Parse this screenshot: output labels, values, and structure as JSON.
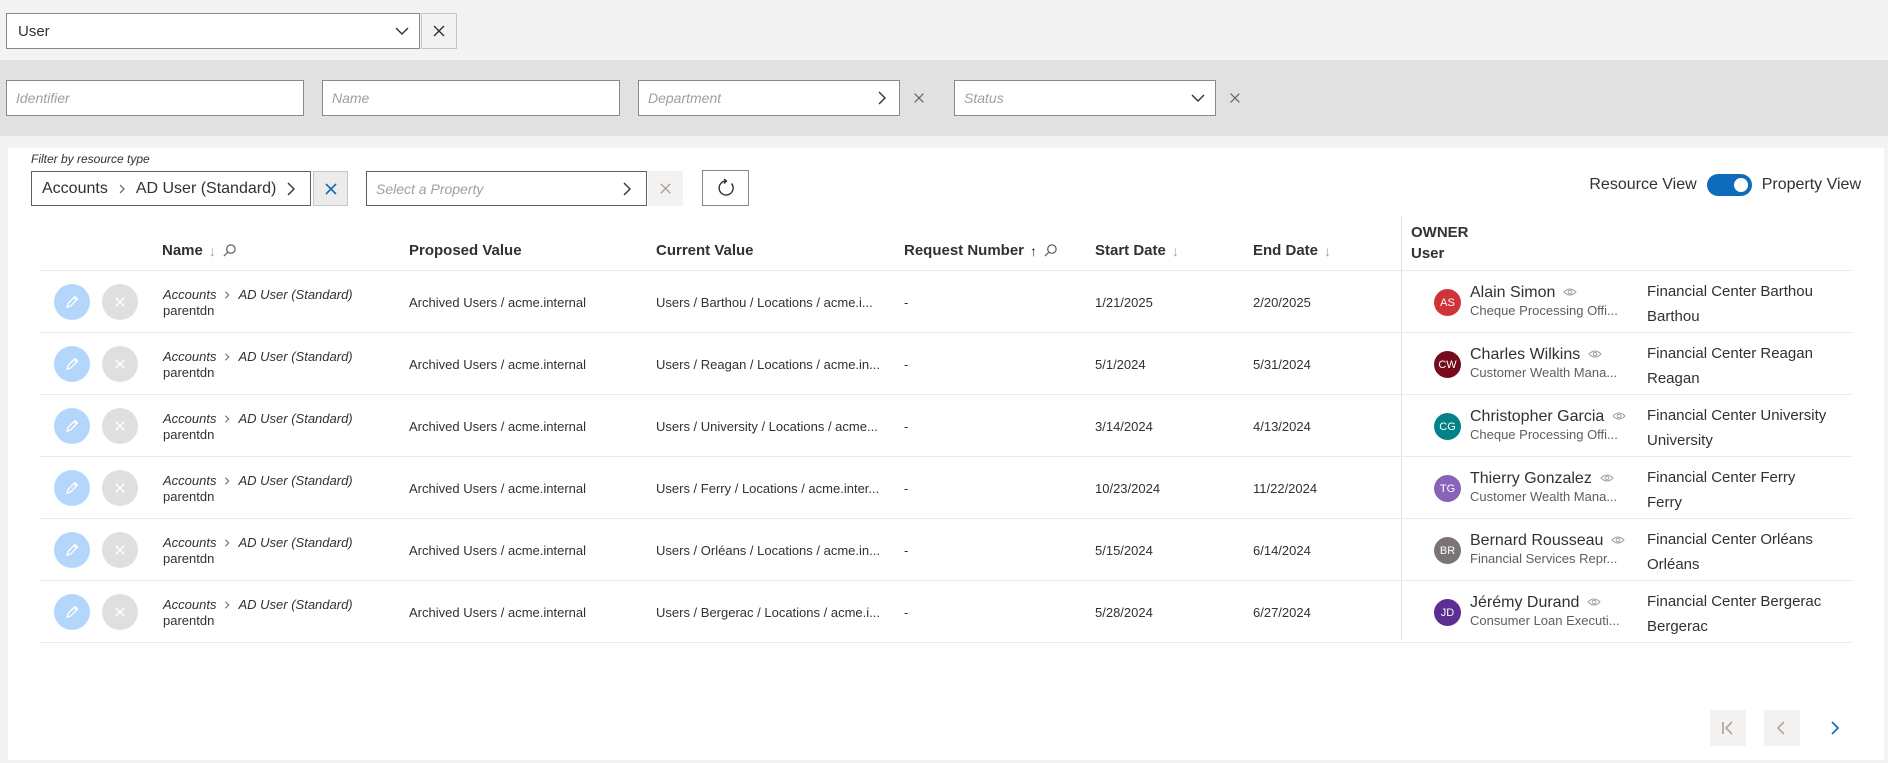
{
  "entity_selector": {
    "value": "User"
  },
  "filters": {
    "identifier_placeholder": "Identifier",
    "name_placeholder": "Name",
    "department_placeholder": "Department",
    "status_placeholder": "Status"
  },
  "resource_filter": {
    "label": "Filter by resource type",
    "crumb_1": "Accounts",
    "crumb_2": "AD User (Standard)",
    "property_placeholder": "Select a Property"
  },
  "view_toggle": {
    "left_label": "Resource View",
    "right_label": "Property View",
    "state": "on"
  },
  "table": {
    "headers": {
      "name": "Name",
      "proposed": "Proposed Value",
      "current": "Current Value",
      "request": "Request Number",
      "start": "Start Date",
      "end": "End Date",
      "owner_1": "OWNER",
      "owner_2": "User"
    },
    "rows": [
      {
        "res_1": "Accounts",
        "res_2": "AD User (Standard)",
        "prop": "parentdn",
        "proposed": "Archived Users / acme.internal",
        "current": "Users / Barthou / Locations / acme.i...",
        "request": "-",
        "start": "1/21/2025",
        "end": "2/20/2025",
        "initials": "AS",
        "avatar_color": "#d13438",
        "owner": "Alain Simon",
        "title": "Cheque Processing Offi...",
        "loc_1": "Financial Center Barthou",
        "loc_2": "Barthou"
      },
      {
        "res_1": "Accounts",
        "res_2": "AD User (Standard)",
        "prop": "parentdn",
        "proposed": "Archived Users / acme.internal",
        "current": "Users / Reagan / Locations / acme.in...",
        "request": "-",
        "start": "5/1/2024",
        "end": "5/31/2024",
        "initials": "CW",
        "avatar_color": "#750b1c",
        "owner": "Charles Wilkins",
        "title": "Customer Wealth Mana...",
        "loc_1": "Financial Center Reagan",
        "loc_2": "Reagan"
      },
      {
        "res_1": "Accounts",
        "res_2": "AD User (Standard)",
        "prop": "parentdn",
        "proposed": "Archived Users / acme.internal",
        "current": "Users / University / Locations / acme...",
        "request": "-",
        "start": "3/14/2024",
        "end": "4/13/2024",
        "initials": "CG",
        "avatar_color": "#038387",
        "owner": "Christopher Garcia",
        "title": "Cheque Processing Offi...",
        "loc_1": "Financial Center University",
        "loc_2": "University"
      },
      {
        "res_1": "Accounts",
        "res_2": "AD User (Standard)",
        "prop": "parentdn",
        "proposed": "Archived Users / acme.internal",
        "current": "Users / Ferry / Locations / acme.inter...",
        "request": "-",
        "start": "10/23/2024",
        "end": "11/22/2024",
        "initials": "TG",
        "avatar_color": "#8764b8",
        "owner": "Thierry Gonzalez",
        "title": "Customer Wealth Mana...",
        "loc_1": "Financial Center Ferry",
        "loc_2": "Ferry"
      },
      {
        "res_1": "Accounts",
        "res_2": "AD User (Standard)",
        "prop": "parentdn",
        "proposed": "Archived Users / acme.internal",
        "current": "Users / Orléans / Locations / acme.in...",
        "request": "-",
        "start": "5/15/2024",
        "end": "6/14/2024",
        "initials": "BR",
        "avatar_color": "#7a7574",
        "owner": "Bernard Rousseau",
        "title": "Financial Services Repr...",
        "loc_1": "Financial Center Orléans",
        "loc_2": "Orléans"
      },
      {
        "res_1": "Accounts",
        "res_2": "AD User (Standard)",
        "prop": "parentdn",
        "proposed": "Archived Users / acme.internal",
        "current": "Users / Bergerac / Locations / acme.i...",
        "request": "-",
        "start": "5/28/2024",
        "end": "6/27/2024",
        "initials": "JD",
        "avatar_color": "#5c2e91",
        "owner": "Jérémy Durand",
        "title": "Consumer Loan Executi...",
        "loc_1": "Financial Center Bergerac",
        "loc_2": "Bergerac"
      }
    ]
  },
  "colors": {
    "accent": "#0f6cbd",
    "edit_circle": "#b4d6fa",
    "delete_circle": "#e1dfdd"
  }
}
